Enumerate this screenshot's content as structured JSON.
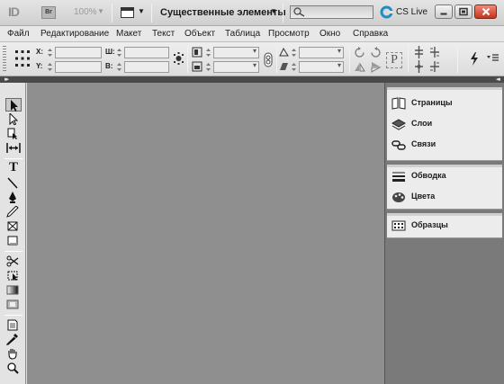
{
  "appbar": {
    "app_logo": "ID",
    "bridge_label": "Br",
    "zoom": "100%",
    "workspace": "Существенные элементы",
    "search_value": "",
    "cslive_label": "CS Live"
  },
  "menu": [
    "Файл",
    "Редактирование",
    "Макет",
    "Текст",
    "Объект",
    "Таблица",
    "Просмотр",
    "Окно",
    "Справка"
  ],
  "control": {
    "x_label": "X:",
    "y_label": "Y:",
    "w_label": "Ш:",
    "h_label": "В:",
    "x_value": "",
    "y_value": "",
    "w_value": "",
    "h_value": ""
  },
  "panels": [
    {
      "label": "Страницы",
      "icon": "pages-icon"
    },
    {
      "label": "Слои",
      "icon": "layers-icon"
    },
    {
      "label": "Связи",
      "icon": "links-icon"
    },
    {
      "label": "Обводка",
      "icon": "stroke-icon"
    },
    {
      "label": "Цвета",
      "icon": "color-icon"
    },
    {
      "label": "Образцы",
      "icon": "swatches-icon"
    }
  ],
  "colors": {
    "canvas": "#8f8f8f",
    "dock_bg": "#7a7a7a",
    "cslive_accent": "#1a8fd0",
    "close_button": "#c4341e"
  }
}
